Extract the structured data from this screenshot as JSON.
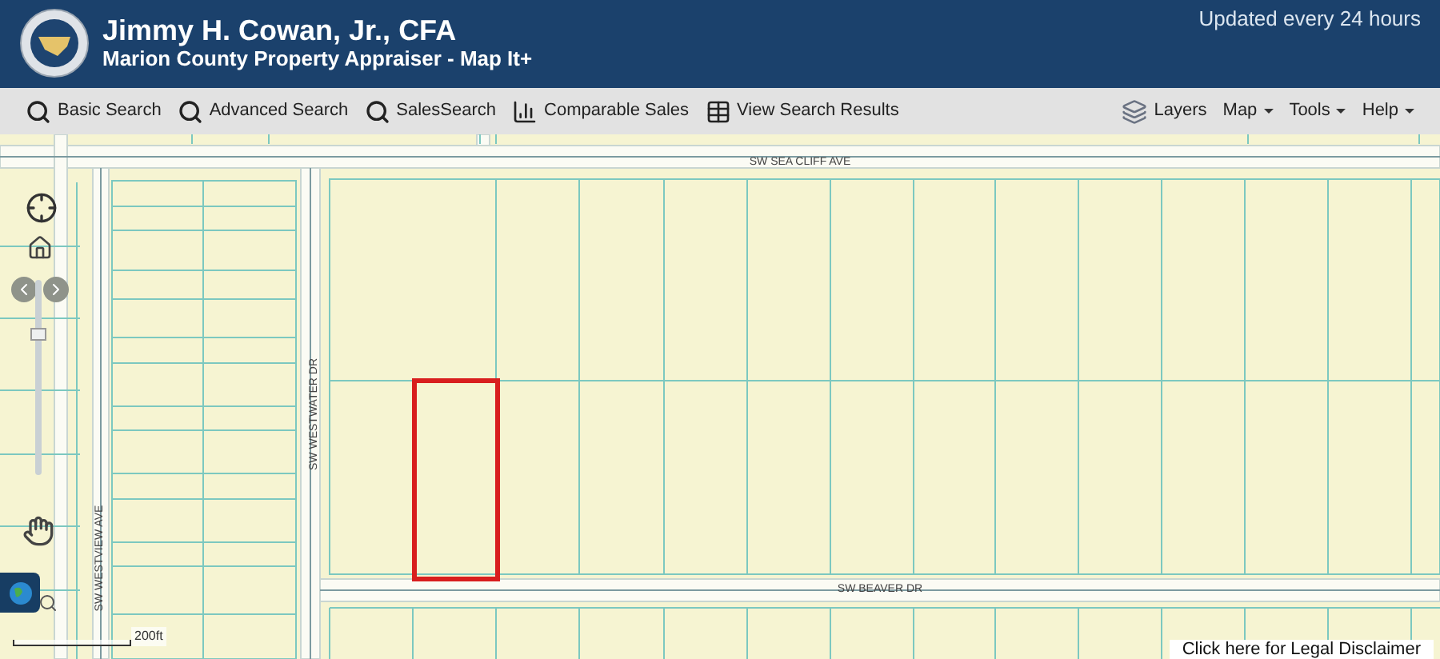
{
  "header": {
    "title": "Jimmy H. Cowan, Jr., CFA",
    "subtitle": "Marion County Property Appraiser - Map It+",
    "update_note": "Updated every 24 hours"
  },
  "toolbar": {
    "items": [
      {
        "label": "Basic Search",
        "kind": "search"
      },
      {
        "label": "Advanced Search",
        "kind": "search"
      },
      {
        "label": "SalesSearch",
        "kind": "search"
      },
      {
        "label": "Comparable Sales",
        "kind": "chart"
      },
      {
        "label": "View Search Results",
        "kind": "table"
      }
    ],
    "menus": [
      {
        "label": "Layers",
        "kind": "layers"
      },
      {
        "label": "Map",
        "kind": "dropdown"
      },
      {
        "label": "Tools",
        "kind": "dropdown"
      },
      {
        "label": "Help",
        "kind": "dropdown"
      }
    ]
  },
  "map": {
    "streets": [
      {
        "label": "SW SEA CLIFF AVE",
        "kind": "horizontal"
      },
      {
        "label": "SW WESTVIEW AVE",
        "kind": "vertical"
      },
      {
        "label": "SW WESTWATER DR",
        "kind": "vertical"
      },
      {
        "label": "SW BEAVER DR",
        "kind": "horizontal"
      }
    ],
    "zoom_slider": {
      "level": 0.74
    },
    "scale": "200ft",
    "disclaimer": "Click here for Legal Disclaimer"
  }
}
